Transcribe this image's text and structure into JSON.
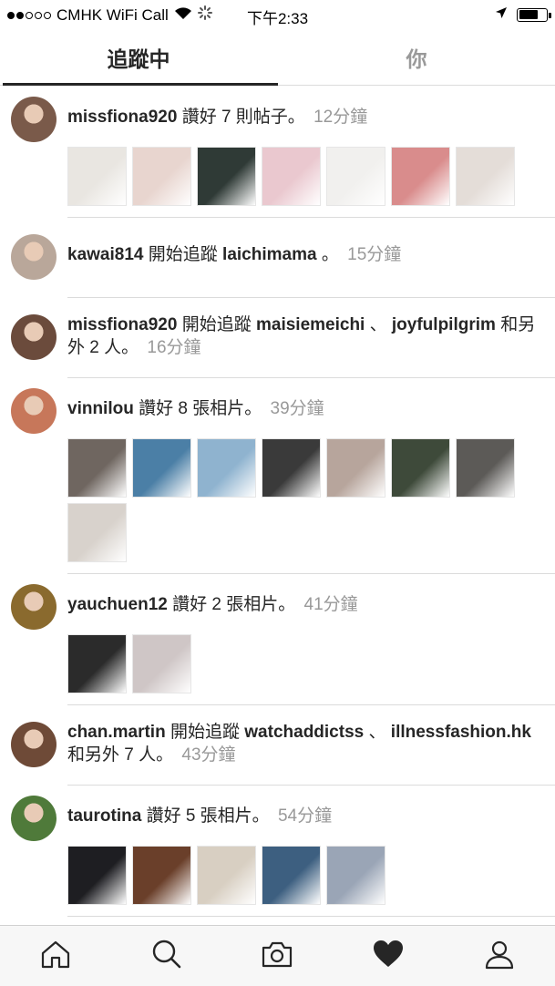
{
  "status_bar": {
    "carrier": "CMHK WiFi Call",
    "time": "下午2:33",
    "signal_dots_on": 2,
    "signal_dots_total": 5,
    "battery_level": 0.7
  },
  "tabs": {
    "following": "追蹤中",
    "you": "你"
  },
  "feed": [
    {
      "avatar_color": "#7a5a4a",
      "user": "missfiona920",
      "action": "讚好 7 則帖子。",
      "time": "12分鐘",
      "thumbs": [
        "#e9e6e1",
        "#e8d5cf",
        "#2f3a36",
        "#eac8cf",
        "#f1f0ee",
        "#d98c8c",
        "#e4ddd8"
      ]
    },
    {
      "avatar_color": "#b9a79a",
      "user": "kawai814",
      "action": "開始追蹤",
      "target": "laichimama",
      "action_end": "。",
      "time": "15分鐘",
      "thumbs": []
    },
    {
      "avatar_color": "#6b4b3c",
      "user": "missfiona920",
      "action": "開始追蹤",
      "target": "maisiemeichi",
      "sep": "、",
      "target2": "joyfulpilgrim",
      "action_end": "和另外 2 人。",
      "time": "16分鐘",
      "thumbs": []
    },
    {
      "avatar_color": "#c7775a",
      "user": "vinnilou",
      "action": "讚好 8 張相片。",
      "time": "39分鐘",
      "thumbs": [
        "#6f6660",
        "#4b7fa6",
        "#8fb3cf",
        "#3a3a3a",
        "#b7a59c",
        "#3e4a3a",
        "#5c5a57",
        "#d8d2cc"
      ]
    },
    {
      "avatar_color": "#8a6a2e",
      "user": "yauchuen12",
      "action": "讚好 2 張相片。",
      "time": "41分鐘",
      "thumbs": [
        "#2b2b2b",
        "#cfc6c6"
      ]
    },
    {
      "avatar_color": "#6e4a37",
      "user": "chan.martin",
      "action": "開始追蹤",
      "target": "watchaddictss",
      "sep": "、",
      "target2": "illnessfashion.hk",
      "action_end": "和另外 7 人。",
      "time": "43分鐘",
      "thumbs": []
    },
    {
      "avatar_color": "#4f7a3a",
      "user": "taurotina",
      "action": "讚好 5 張相片。",
      "time": "54分鐘",
      "thumbs": [
        "#1e1e22",
        "#6a3f2a",
        "#d8cfc2",
        "#3d5f80",
        "#9aa5b6"
      ]
    }
  ],
  "bottom_nav": {
    "home": "home-icon",
    "search": "search-icon",
    "camera": "camera-icon",
    "activity": "heart-icon",
    "profile": "profile-icon"
  }
}
